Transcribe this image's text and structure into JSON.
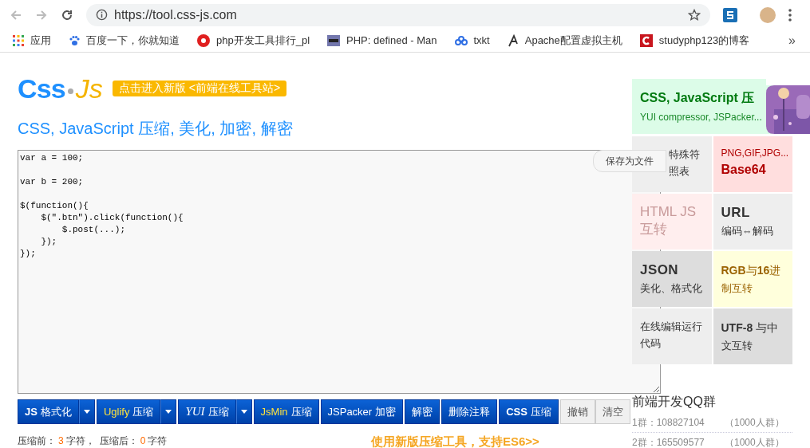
{
  "browser": {
    "url": "https://tool.css-js.com",
    "bookmarks": [
      {
        "label": "应用"
      },
      {
        "label": "百度一下，你就知道"
      },
      {
        "label": "php开发工具排行_pl"
      },
      {
        "label": "PHP: defined - Man"
      },
      {
        "label": "txkt"
      },
      {
        "label": "Apache配置虚拟主机"
      },
      {
        "label": "studyphp123的博客"
      }
    ],
    "overflow": "»"
  },
  "logo": {
    "first": "Css",
    "second": "Js"
  },
  "new_version_badge": "点击进入新版 <前端在线工具站>",
  "heading": "CSS, JavaScript 压缩, 美化, 加密, 解密",
  "editor": {
    "value": "var a = 100;\n\nvar b = 200;\n\n$(function(){\n    $(\".btn\").click(function(){\n        $.post(...);\n    });\n});"
  },
  "save_tab": "保存为文件",
  "buttons": [
    {
      "kind": "split",
      "prefix": "JS",
      "label": "格式化"
    },
    {
      "kind": "split",
      "prefix": "Uglify",
      "label": "压缩"
    },
    {
      "kind": "split",
      "prefix": "YUI",
      "label": "压缩"
    },
    {
      "kind": "single",
      "prefix": "JsMin",
      "label": "压缩"
    },
    {
      "kind": "single",
      "prefix": "JSPacker",
      "label": "加密"
    },
    {
      "kind": "single",
      "label": "解密"
    },
    {
      "kind": "single",
      "label": "删除注释"
    },
    {
      "kind": "single",
      "prefix": "CSS",
      "label": "压缩"
    },
    {
      "kind": "light",
      "label": "撤销"
    },
    {
      "kind": "light",
      "label": "清空"
    }
  ],
  "stats": [
    {
      "label": "压缩前：",
      "count": "3",
      "unit": "字符，"
    },
    {
      "label": "压缩后：",
      "count": "0",
      "unit": "字符"
    }
  ],
  "new_tool_link": "使用新版压缩工具，支持ES6>>",
  "sidebar": {
    "feature": {
      "title": "CSS, JavaScript 压",
      "subtitle": "YUI compressor, JSPacker..."
    },
    "tiles": [
      {
        "kind": "plain",
        "lines": [
          "特殊符",
          "照表"
        ]
      },
      {
        "kind": "caption-title",
        "lines": [
          "PNG,GIF,JPG...",
          "Base64"
        ]
      },
      {
        "kind": "big",
        "lines": [
          "HTML JS",
          "互转"
        ]
      },
      {
        "kind": "title-caption",
        "lines": [
          "URL",
          "编码⇔解码"
        ]
      },
      {
        "kind": "title-caption",
        "lines": [
          "JSON",
          "美化、格式化"
        ]
      },
      {
        "kind": "mixed",
        "lines": [
          "**RGB**与**16**进",
          "制互转"
        ]
      },
      {
        "kind": "plain",
        "lines": [
          "在线编辑运行",
          "代码"
        ]
      },
      {
        "kind": "mixed",
        "lines": [
          "**UTF-8** 与中",
          "文互转"
        ]
      }
    ],
    "qq": {
      "title": "前端开发QQ群",
      "groups": [
        {
          "number": "1群：108827104",
          "size": "（1000人群）"
        },
        {
          "number": "2群：165509577",
          "size": "（1000人群）"
        }
      ]
    }
  }
}
